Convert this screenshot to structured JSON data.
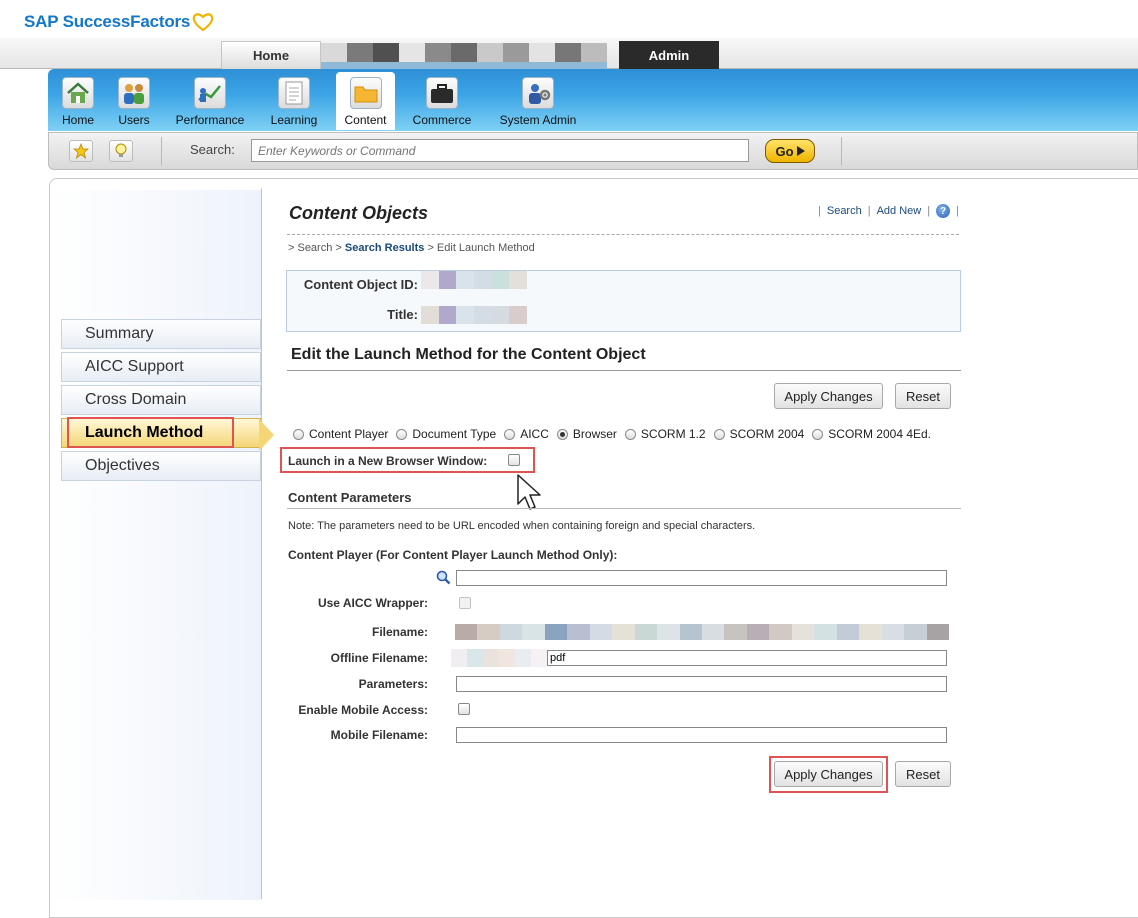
{
  "brand": {
    "name": "SAP SuccessFactors"
  },
  "top_tabs": {
    "home": "Home",
    "admin": "Admin"
  },
  "nav": {
    "items": [
      {
        "label": "Home",
        "icon": "home-icon"
      },
      {
        "label": "Users",
        "icon": "users-icon"
      },
      {
        "label": "Performance",
        "icon": "performance-chart-icon"
      },
      {
        "label": "Learning",
        "icon": "document-icon"
      },
      {
        "label": "Content",
        "icon": "folder-icon"
      },
      {
        "label": "Commerce",
        "icon": "briefcase-icon"
      },
      {
        "label": "System Admin",
        "icon": "system-admin-icon"
      }
    ],
    "active": "Content"
  },
  "search": {
    "label": "Search:",
    "placeholder": "Enter Keywords or Command",
    "go": "Go"
  },
  "sidebar": {
    "items": [
      {
        "label": "Summary"
      },
      {
        "label": "AICC Support"
      },
      {
        "label": "Cross Domain"
      },
      {
        "label": "Launch Method"
      },
      {
        "label": "Objectives"
      }
    ],
    "active": "Launch Method"
  },
  "page": {
    "title": "Content Objects",
    "links": {
      "search": "Search",
      "add_new": "Add New",
      "sep": "|"
    },
    "breadcrumb": {
      "prefix": "> Search >",
      "current_link": "Search Results",
      "tail": "> Edit Launch Method"
    },
    "info": {
      "id_label": "Content Object ID:",
      "title_label": "Title:"
    },
    "section_title": "Edit the Launch Method for the Content Object",
    "apply": "Apply Changes",
    "reset": "Reset",
    "launch_methods": [
      {
        "label": "Content Player",
        "selected": false
      },
      {
        "label": "Document Type",
        "selected": false
      },
      {
        "label": "AICC",
        "selected": false
      },
      {
        "label": "Browser",
        "selected": true
      },
      {
        "label": "SCORM 1.2",
        "selected": false
      },
      {
        "label": "SCORM 2004",
        "selected": false
      },
      {
        "label": "SCORM 2004 4Ed.",
        "selected": false
      }
    ],
    "new_window_label": "Launch in a New Browser Window:",
    "params_title": "Content Parameters",
    "note": "Note: The parameters need to be URL encoded when containing foreign and special characters.",
    "player_title": "Content Player (For Content Player Launch Method Only):",
    "fields": {
      "aicc_wrapper": "Use AICC Wrapper:",
      "filename": "Filename:",
      "offline_filename": "Offline Filename:",
      "offline_value_suffix": "pdf",
      "parameters": "Parameters:",
      "mobile_access": "Enable Mobile Access:",
      "mobile_filename": "Mobile Filename:"
    }
  },
  "colors": {
    "accent": "#1478c8",
    "highlight": "#e05353",
    "active_tab": "#f4d677"
  }
}
